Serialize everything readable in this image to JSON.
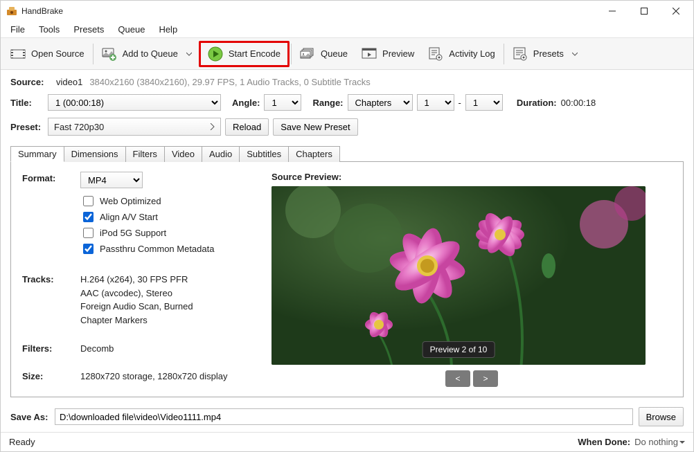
{
  "app": {
    "title": "HandBrake"
  },
  "menu": [
    "File",
    "Tools",
    "Presets",
    "Queue",
    "Help"
  ],
  "toolbar": {
    "open_source": "Open Source",
    "add_queue": "Add to Queue",
    "start_encode": "Start Encode",
    "queue": "Queue",
    "preview": "Preview",
    "activity_log": "Activity Log",
    "presets": "Presets"
  },
  "source": {
    "label": "Source:",
    "name": "video1",
    "info": "3840x2160 (3840x2160), 29.97 FPS, 1 Audio Tracks, 0 Subtitle Tracks"
  },
  "titlerow": {
    "title_label": "Title:",
    "title_value": "1  (00:00:18)",
    "angle_label": "Angle:",
    "angle_value": "1",
    "range_label": "Range:",
    "range_type": "Chapters",
    "range_from": "1",
    "range_dash": "-",
    "range_to": "1",
    "duration_label": "Duration:",
    "duration_value": "00:00:18"
  },
  "presetrow": {
    "label": "Preset:",
    "value": "Fast 720p30",
    "reload": "Reload",
    "save_new": "Save New Preset"
  },
  "tabs": [
    "Summary",
    "Dimensions",
    "Filters",
    "Video",
    "Audio",
    "Subtitles",
    "Chapters"
  ],
  "summary": {
    "format_label": "Format:",
    "format_value": "MP4",
    "chk_web": "Web Optimized",
    "chk_align": "Align A/V Start",
    "chk_ipod": "iPod 5G Support",
    "chk_passthru": "Passthru Common Metadata",
    "tracks_label": "Tracks:",
    "tracks_lines": [
      "H.264 (x264), 30 FPS PFR",
      "AAC (avcodec), Stereo",
      "Foreign Audio Scan, Burned",
      "Chapter Markers"
    ],
    "filters_label": "Filters:",
    "filters_value": "Decomb",
    "size_label": "Size:",
    "size_value": "1280x720 storage, 1280x720 display"
  },
  "preview": {
    "title": "Source Preview:",
    "counter": "Preview 2 of 10",
    "prev": "<",
    "next": ">"
  },
  "save": {
    "label": "Save As:",
    "path": "D:\\downloaded file\\video\\Video1111.mp4",
    "browse": "Browse"
  },
  "status": {
    "ready": "Ready",
    "when_done_label": "When Done:",
    "when_done_value": "Do nothing"
  }
}
